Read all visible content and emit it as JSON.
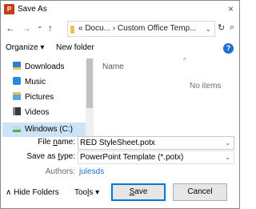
{
  "window": {
    "app_icon_text": "P",
    "title": "Save As",
    "close_glyph": "×"
  },
  "nav": {
    "back_glyph": "←",
    "forward_glyph": "→",
    "recent_glyph": "⌄",
    "up_glyph": "↑",
    "address_path": "« Docu... › Custom Office Temp...",
    "address_caret": "⌄",
    "refresh_glyph": "↻",
    "search_glyph": "⌕"
  },
  "toolbar": {
    "organize_label": "Organize ▾",
    "new_folder_label": "New folder",
    "help_glyph": "?"
  },
  "sidebar": {
    "items": [
      {
        "label": "Downloads",
        "icon": "downloads-icon"
      },
      {
        "label": "Music",
        "icon": "music-icon"
      },
      {
        "label": "Pictures",
        "icon": "pictures-icon"
      },
      {
        "label": "Videos",
        "icon": "videos-icon"
      },
      {
        "label": "Windows (C:)",
        "icon": "drive-icon",
        "selected": true
      }
    ],
    "scroll_up": "▴",
    "scroll_left": "‹",
    "scroll_down": "⌄"
  },
  "filelist": {
    "column_name": "Name",
    "sort_glyph": "^",
    "empty_text": "No items",
    "scroll_right": "›"
  },
  "form": {
    "file_name_label_pre": "File ",
    "file_name_label_ul": "n",
    "file_name_label_post": "ame:",
    "file_name_value": "RED StyleSheet.potx",
    "save_type_label_pre": "Save as ",
    "save_type_label_ul": "t",
    "save_type_label_post": "ype:",
    "save_type_value": "PowerPoint Template (*.potx)",
    "authors_label": "Authors:",
    "authors_value": "julesds",
    "caret": "⌄"
  },
  "footer": {
    "hide_folders_label": "∧  Hide Folders",
    "tools_pre": "Too",
    "tools_ul": "l",
    "tools_post": "s  ▾",
    "save_pre": "",
    "save_ul": "S",
    "save_post": "ave",
    "cancel_label": "Cancel"
  },
  "colors": {
    "accent": "#0078d7",
    "selection": "#cce4f7",
    "powerpoint": "#c43e1c"
  }
}
